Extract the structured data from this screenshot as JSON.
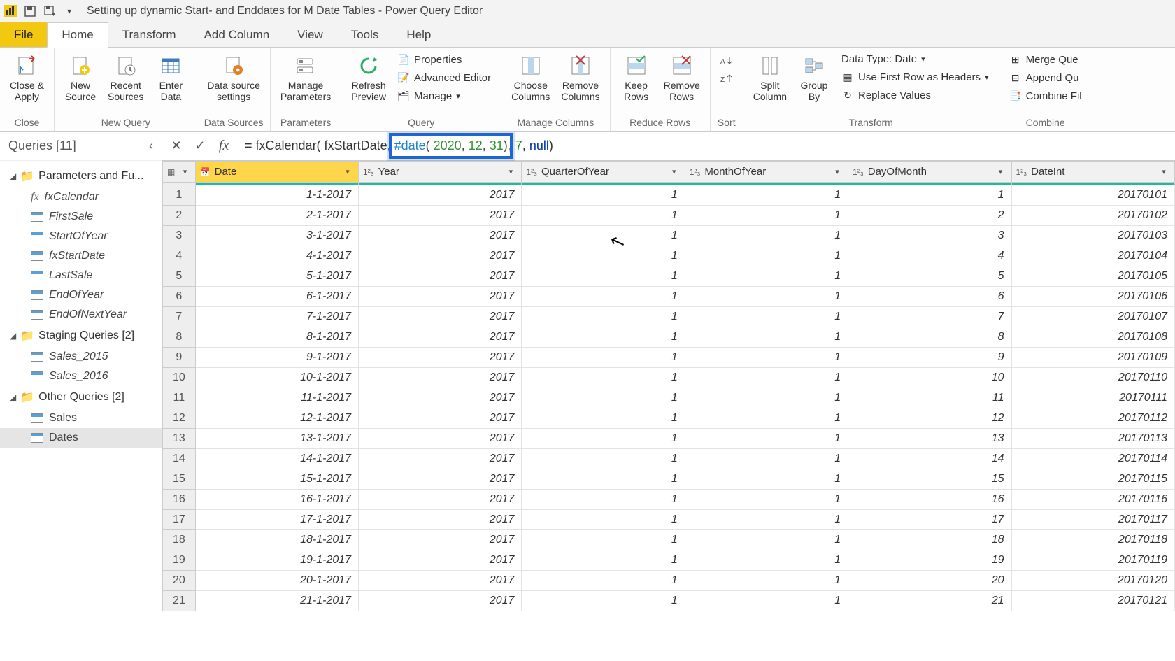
{
  "titlebar": {
    "title": "Setting up dynamic Start- and Enddates for M Date Tables - Power Query Editor"
  },
  "tabs": {
    "file": "File",
    "home": "Home",
    "transform": "Transform",
    "add_column": "Add Column",
    "view": "View",
    "tools": "Tools",
    "help": "Help"
  },
  "ribbon": {
    "close": {
      "close_apply": "Close &\nApply",
      "group": "Close"
    },
    "new_query": {
      "new_source": "New\nSource",
      "recent_sources": "Recent\nSources",
      "enter_data": "Enter\nData",
      "group": "New Query"
    },
    "data_sources": {
      "data_source_settings": "Data source\nsettings",
      "group": "Data Sources"
    },
    "parameters": {
      "manage_parameters": "Manage\nParameters",
      "group": "Parameters"
    },
    "query": {
      "refresh_preview": "Refresh\nPreview",
      "properties": "Properties",
      "advanced_editor": "Advanced Editor",
      "manage": "Manage",
      "group": "Query"
    },
    "manage_columns": {
      "choose_columns": "Choose\nColumns",
      "remove_columns": "Remove\nColumns",
      "group": "Manage Columns"
    },
    "reduce_rows": {
      "keep_rows": "Keep\nRows",
      "remove_rows": "Remove\nRows",
      "group": "Reduce Rows"
    },
    "sort": {
      "group": "Sort"
    },
    "transform": {
      "split_column": "Split\nColumn",
      "group_by": "Group\nBy",
      "data_type": "Data Type: Date",
      "first_row_headers": "Use First Row as Headers",
      "replace_values": "Replace Values",
      "group": "Transform"
    },
    "combine": {
      "merge": "Merge Que",
      "append": "Append Qu",
      "combine_files": "Combine Fil",
      "group": "Combine"
    }
  },
  "queries_pane": {
    "header": "Queries [11]",
    "group1": "Parameters and Fu...",
    "group1_items": [
      "fxCalendar",
      "FirstSale",
      "StartOfYear",
      "fxStartDate",
      "LastSale",
      "EndOfYear",
      "EndOfNextYear"
    ],
    "group2": "Staging Queries [2]",
    "group2_items": [
      "Sales_2015",
      "Sales_2016"
    ],
    "group3": "Other Queries [2]",
    "group3_items": [
      "Sales",
      "Dates"
    ]
  },
  "formula": {
    "prefix": "= fxCalendar( fxStartDate, ",
    "highlight_fn": "#date",
    "highlight_open": "( ",
    "highlight_n1": "2020",
    "highlight_c1": ", ",
    "highlight_n2": "12",
    "highlight_c2": ", ",
    "highlight_n3": "31",
    "highlight_close": ")",
    "after_comma": ", ",
    "after_num": "7",
    "after_comma2": ", ",
    "after_null": "null",
    "after_close": ")"
  },
  "columns": [
    "Date",
    "Year",
    "QuarterOfYear",
    "MonthOfYear",
    "DayOfMonth",
    "DateInt"
  ],
  "rows": [
    {
      "n": 1,
      "Date": "1-1-2017",
      "Year": 2017,
      "QuarterOfYear": 1,
      "MonthOfYear": 1,
      "DayOfMonth": 1,
      "DateInt": 20170101
    },
    {
      "n": 2,
      "Date": "2-1-2017",
      "Year": 2017,
      "QuarterOfYear": 1,
      "MonthOfYear": 1,
      "DayOfMonth": 2,
      "DateInt": 20170102
    },
    {
      "n": 3,
      "Date": "3-1-2017",
      "Year": 2017,
      "QuarterOfYear": 1,
      "MonthOfYear": 1,
      "DayOfMonth": 3,
      "DateInt": 20170103
    },
    {
      "n": 4,
      "Date": "4-1-2017",
      "Year": 2017,
      "QuarterOfYear": 1,
      "MonthOfYear": 1,
      "DayOfMonth": 4,
      "DateInt": 20170104
    },
    {
      "n": 5,
      "Date": "5-1-2017",
      "Year": 2017,
      "QuarterOfYear": 1,
      "MonthOfYear": 1,
      "DayOfMonth": 5,
      "DateInt": 20170105
    },
    {
      "n": 6,
      "Date": "6-1-2017",
      "Year": 2017,
      "QuarterOfYear": 1,
      "MonthOfYear": 1,
      "DayOfMonth": 6,
      "DateInt": 20170106
    },
    {
      "n": 7,
      "Date": "7-1-2017",
      "Year": 2017,
      "QuarterOfYear": 1,
      "MonthOfYear": 1,
      "DayOfMonth": 7,
      "DateInt": 20170107
    },
    {
      "n": 8,
      "Date": "8-1-2017",
      "Year": 2017,
      "QuarterOfYear": 1,
      "MonthOfYear": 1,
      "DayOfMonth": 8,
      "DateInt": 20170108
    },
    {
      "n": 9,
      "Date": "9-1-2017",
      "Year": 2017,
      "QuarterOfYear": 1,
      "MonthOfYear": 1,
      "DayOfMonth": 9,
      "DateInt": 20170109
    },
    {
      "n": 10,
      "Date": "10-1-2017",
      "Year": 2017,
      "QuarterOfYear": 1,
      "MonthOfYear": 1,
      "DayOfMonth": 10,
      "DateInt": 20170110
    },
    {
      "n": 11,
      "Date": "11-1-2017",
      "Year": 2017,
      "QuarterOfYear": 1,
      "MonthOfYear": 1,
      "DayOfMonth": 11,
      "DateInt": 20170111
    },
    {
      "n": 12,
      "Date": "12-1-2017",
      "Year": 2017,
      "QuarterOfYear": 1,
      "MonthOfYear": 1,
      "DayOfMonth": 12,
      "DateInt": 20170112
    },
    {
      "n": 13,
      "Date": "13-1-2017",
      "Year": 2017,
      "QuarterOfYear": 1,
      "MonthOfYear": 1,
      "DayOfMonth": 13,
      "DateInt": 20170113
    },
    {
      "n": 14,
      "Date": "14-1-2017",
      "Year": 2017,
      "QuarterOfYear": 1,
      "MonthOfYear": 1,
      "DayOfMonth": 14,
      "DateInt": 20170114
    },
    {
      "n": 15,
      "Date": "15-1-2017",
      "Year": 2017,
      "QuarterOfYear": 1,
      "MonthOfYear": 1,
      "DayOfMonth": 15,
      "DateInt": 20170115
    },
    {
      "n": 16,
      "Date": "16-1-2017",
      "Year": 2017,
      "QuarterOfYear": 1,
      "MonthOfYear": 1,
      "DayOfMonth": 16,
      "DateInt": 20170116
    },
    {
      "n": 17,
      "Date": "17-1-2017",
      "Year": 2017,
      "QuarterOfYear": 1,
      "MonthOfYear": 1,
      "DayOfMonth": 17,
      "DateInt": 20170117
    },
    {
      "n": 18,
      "Date": "18-1-2017",
      "Year": 2017,
      "QuarterOfYear": 1,
      "MonthOfYear": 1,
      "DayOfMonth": 18,
      "DateInt": 20170118
    },
    {
      "n": 19,
      "Date": "19-1-2017",
      "Year": 2017,
      "QuarterOfYear": 1,
      "MonthOfYear": 1,
      "DayOfMonth": 19,
      "DateInt": 20170119
    },
    {
      "n": 20,
      "Date": "20-1-2017",
      "Year": 2017,
      "QuarterOfYear": 1,
      "MonthOfYear": 1,
      "DayOfMonth": 20,
      "DateInt": 20170120
    },
    {
      "n": 21,
      "Date": "21-1-2017",
      "Year": 2017,
      "QuarterOfYear": 1,
      "MonthOfYear": 1,
      "DayOfMonth": 21,
      "DateInt": 20170121
    }
  ]
}
